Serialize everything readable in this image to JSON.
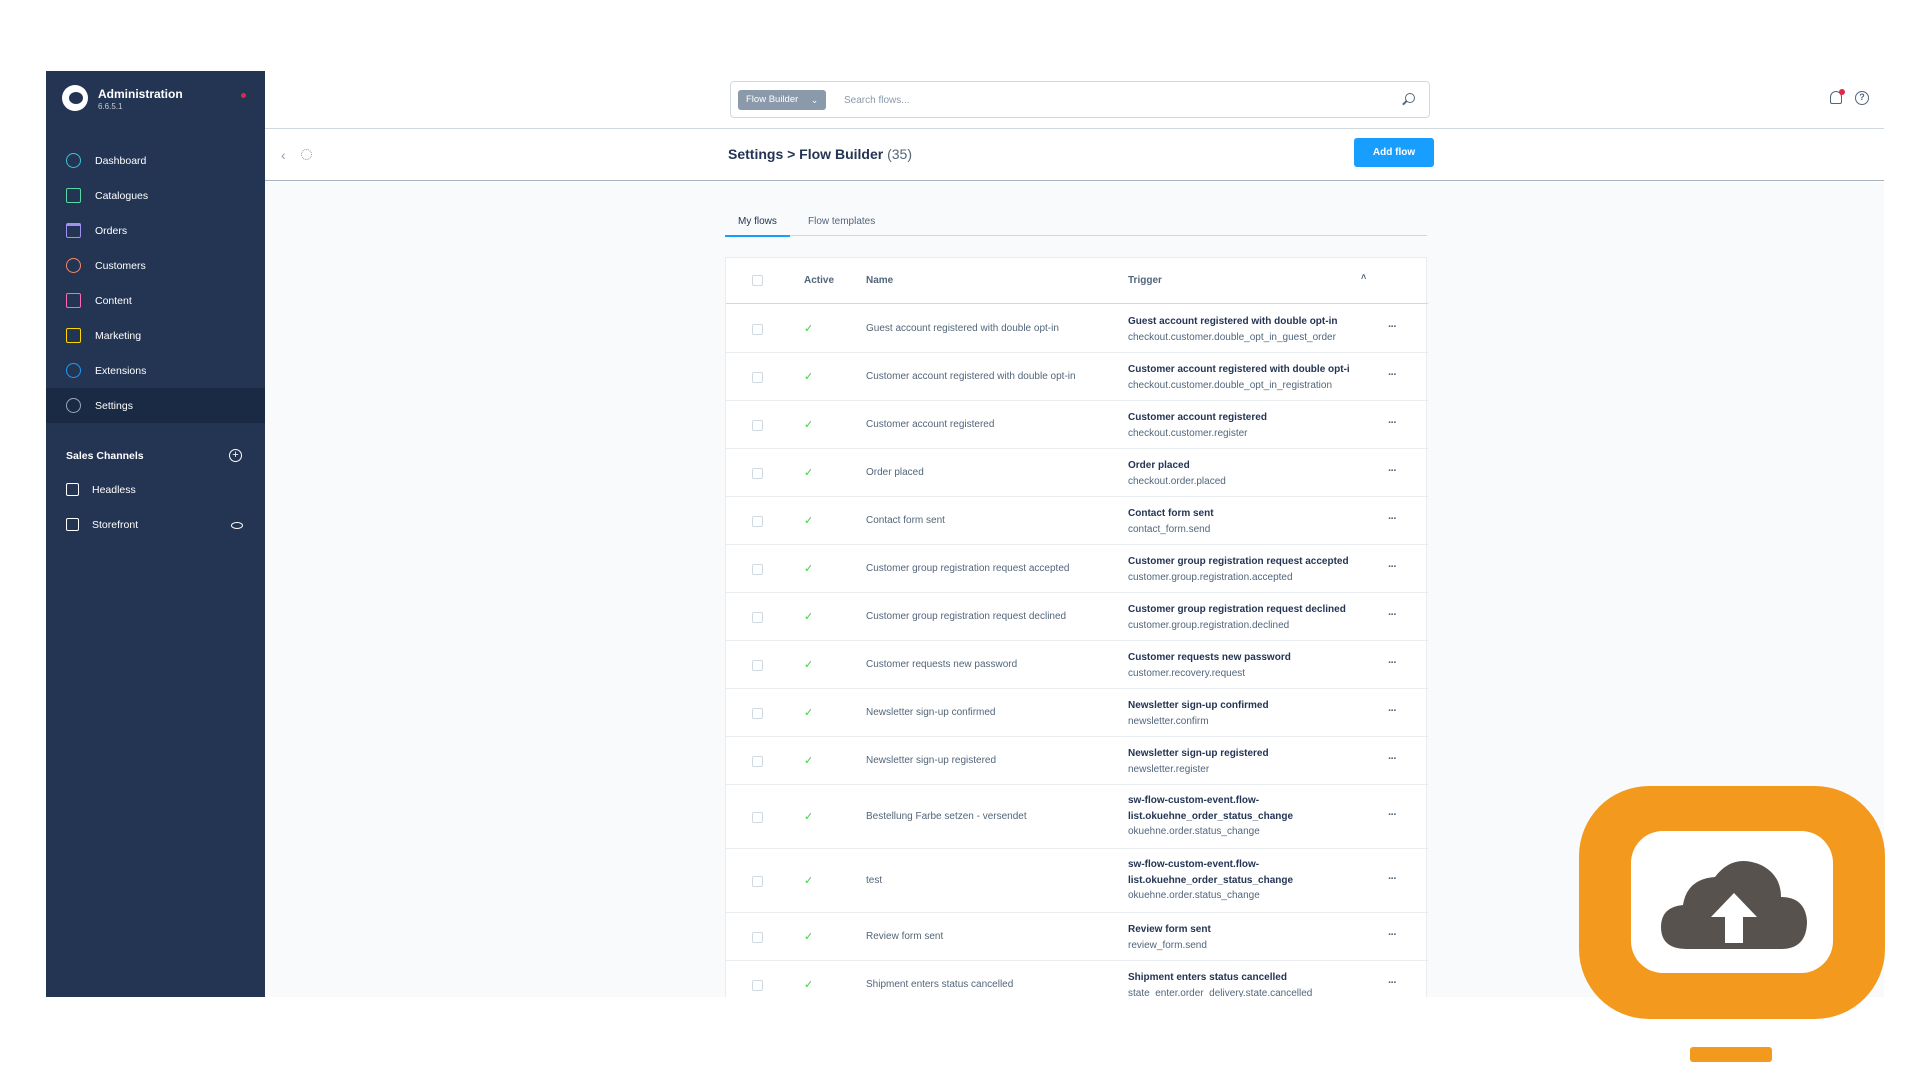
{
  "brand": {
    "title": "Administration",
    "version": "6.6.5.1"
  },
  "sidebar": {
    "items": [
      {
        "label": "Dashboard",
        "icon": "dashboard-icon",
        "color": "#3ac5d6"
      },
      {
        "label": "Catalogues",
        "icon": "catalogues-icon",
        "color": "#57d9a3"
      },
      {
        "label": "Orders",
        "icon": "orders-icon",
        "color": "#a092f0"
      },
      {
        "label": "Customers",
        "icon": "customers-icon",
        "color": "#f88962"
      },
      {
        "label": "Content",
        "icon": "content-icon",
        "color": "#ff68b4"
      },
      {
        "label": "Marketing",
        "icon": "marketing-icon",
        "color": "#ffd700"
      },
      {
        "label": "Extensions",
        "icon": "extensions-icon",
        "color": "#189eff"
      },
      {
        "label": "Settings",
        "icon": "settings-icon",
        "color": "#9aa8b5",
        "active": true
      }
    ],
    "sales_channels_title": "Sales Channels",
    "sales_channels": [
      {
        "label": "Headless",
        "icon": "basket-icon"
      },
      {
        "label": "Storefront",
        "icon": "storefront-icon"
      }
    ]
  },
  "search": {
    "scope": "Flow Builder",
    "placeholder": "Search flows..."
  },
  "smartbar": {
    "title": "Settings > Flow Builder",
    "count": "(35)",
    "add_label": "Add flow"
  },
  "tabs": [
    {
      "label": "My flows",
      "active": true
    },
    {
      "label": "Flow templates"
    }
  ],
  "table": {
    "columns": {
      "active": "Active",
      "name": "Name",
      "trigger": "Trigger"
    },
    "rows": [
      {
        "name": "Guest account registered with double opt-in",
        "trigger_label": "Guest account registered with double opt-in",
        "trigger_event": "checkout.customer.double_opt_in_guest_order"
      },
      {
        "name": "Customer account registered with double opt-in",
        "trigger_label": "Customer account registered with double opt-i",
        "trigger_event": "checkout.customer.double_opt_in_registration"
      },
      {
        "name": "Customer account registered",
        "trigger_label": "Customer account registered",
        "trigger_event": "checkout.customer.register"
      },
      {
        "name": "Order placed",
        "trigger_label": "Order placed",
        "trigger_event": "checkout.order.placed"
      },
      {
        "name": "Contact form sent",
        "trigger_label": "Contact form sent",
        "trigger_event": "contact_form.send"
      },
      {
        "name": "Customer group registration request accepted",
        "trigger_label": "Customer group registration request accepted",
        "trigger_event": "customer.group.registration.accepted"
      },
      {
        "name": "Customer group registration request declined",
        "trigger_label": "Customer group registration request declined",
        "trigger_event": "customer.group.registration.declined"
      },
      {
        "name": "Customer requests new password",
        "trigger_label": "Customer requests new password",
        "trigger_event": "customer.recovery.request"
      },
      {
        "name": "Newsletter sign-up confirmed",
        "trigger_label": "Newsletter sign-up confirmed",
        "trigger_event": "newsletter.confirm"
      },
      {
        "name": "Newsletter sign-up registered",
        "trigger_label": "Newsletter sign-up registered",
        "trigger_event": "newsletter.register"
      },
      {
        "name": "Bestellung Farbe setzen - versendet",
        "trigger_label": "sw-flow-custom-event.flow-",
        "trigger_label2": "list.okuehne_order_status_change",
        "trigger_event": "okuehne.order.status_change"
      },
      {
        "name": "test",
        "trigger_label": "sw-flow-custom-event.flow-",
        "trigger_label2": "list.okuehne_order_status_change",
        "trigger_event": "okuehne.order.status_change"
      },
      {
        "name": "Review form sent",
        "trigger_label": "Review form sent",
        "trigger_event": "review_form.send"
      },
      {
        "name": "Shipment enters status cancelled",
        "trigger_label": "Shipment enters status cancelled",
        "trigger_event": "state_enter.order_delivery.state.cancelled"
      }
    ]
  },
  "overlay": {
    "icon": "cloud-upload-icon",
    "color": "#f39a1e"
  }
}
